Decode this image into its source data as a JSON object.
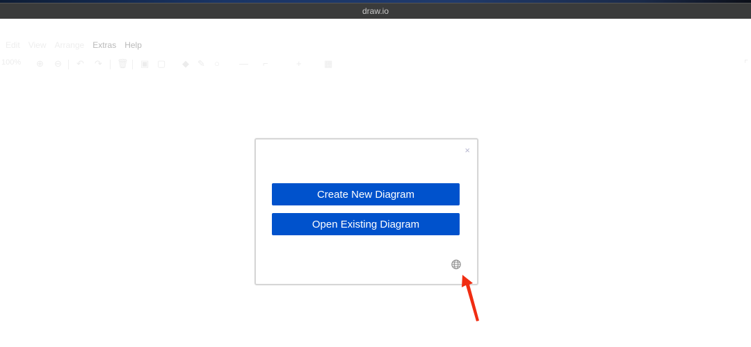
{
  "window": {
    "title": "draw.io"
  },
  "menubar": {
    "items": [
      {
        "label": "Edit",
        "faded": true
      },
      {
        "label": "View",
        "faded": true
      },
      {
        "label": "Arrange",
        "faded": true
      },
      {
        "label": "Extras",
        "faded": false
      },
      {
        "label": "Help",
        "faded": false
      }
    ]
  },
  "toolbar": {
    "zoom_label": "100%",
    "icons": [
      "zoom-in-icon",
      "zoom-out-icon",
      "undo-icon",
      "redo-icon",
      "delete-icon",
      "to-front-icon",
      "to-back-icon",
      "fill-color-icon",
      "line-color-icon",
      "shadow-icon",
      "connection-icon",
      "waypoints-icon",
      "insert-icon",
      "table-icon",
      "fullscreen-icon"
    ]
  },
  "dialog": {
    "close_label": "×",
    "create_button": "Create New Diagram",
    "open_button": "Open Existing Diagram",
    "language_icon": "globe-icon"
  },
  "annotation": {
    "arrow_color": "#f02d12",
    "points_to": "globe-icon"
  },
  "colors": {
    "primary_button": "#0052cc",
    "titlebar": "#3a3b3b"
  }
}
